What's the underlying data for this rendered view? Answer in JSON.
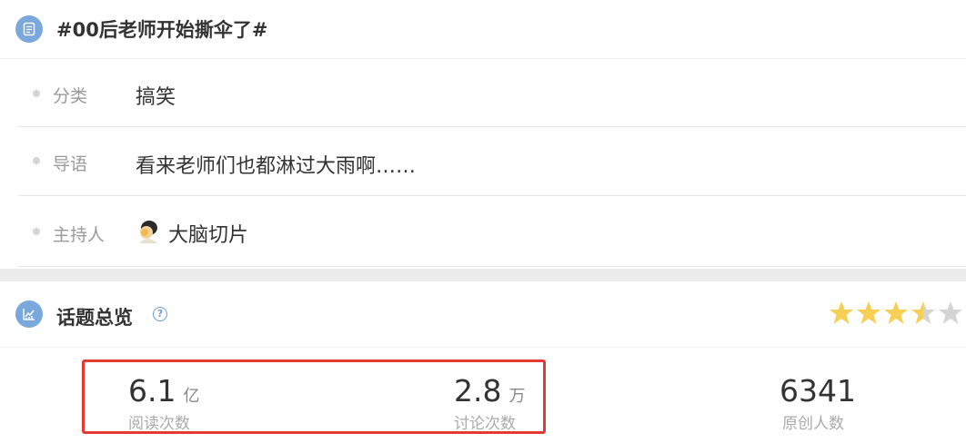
{
  "topic": {
    "title": "#00后老师开始撕伞了#",
    "icon": "list-icon"
  },
  "info": {
    "category": {
      "label": "分类",
      "value": "搞笑"
    },
    "intro": {
      "label": "导语",
      "value": "看来老师们也都淋过大雨啊……"
    },
    "host": {
      "label": "主持人",
      "value": "大脑切片",
      "avatar": "avatar"
    }
  },
  "overview": {
    "title": "话题总览",
    "help_icon": "question-circle-icon",
    "icon": "chart-icon",
    "rating": 3.5,
    "rating_max": 5,
    "colors": {
      "star_on": "#f7cf55",
      "star_off": "#d4d4d4",
      "highlight": "#e53935",
      "accent": "#7aa8dd"
    }
  },
  "stats": {
    "reads": {
      "value": "6.1",
      "unit": "亿",
      "label": "阅读次数"
    },
    "discussions": {
      "value": "2.8",
      "unit": "万",
      "label": "讨论次数"
    },
    "originals": {
      "value": "6341",
      "label": "原创人数"
    }
  }
}
